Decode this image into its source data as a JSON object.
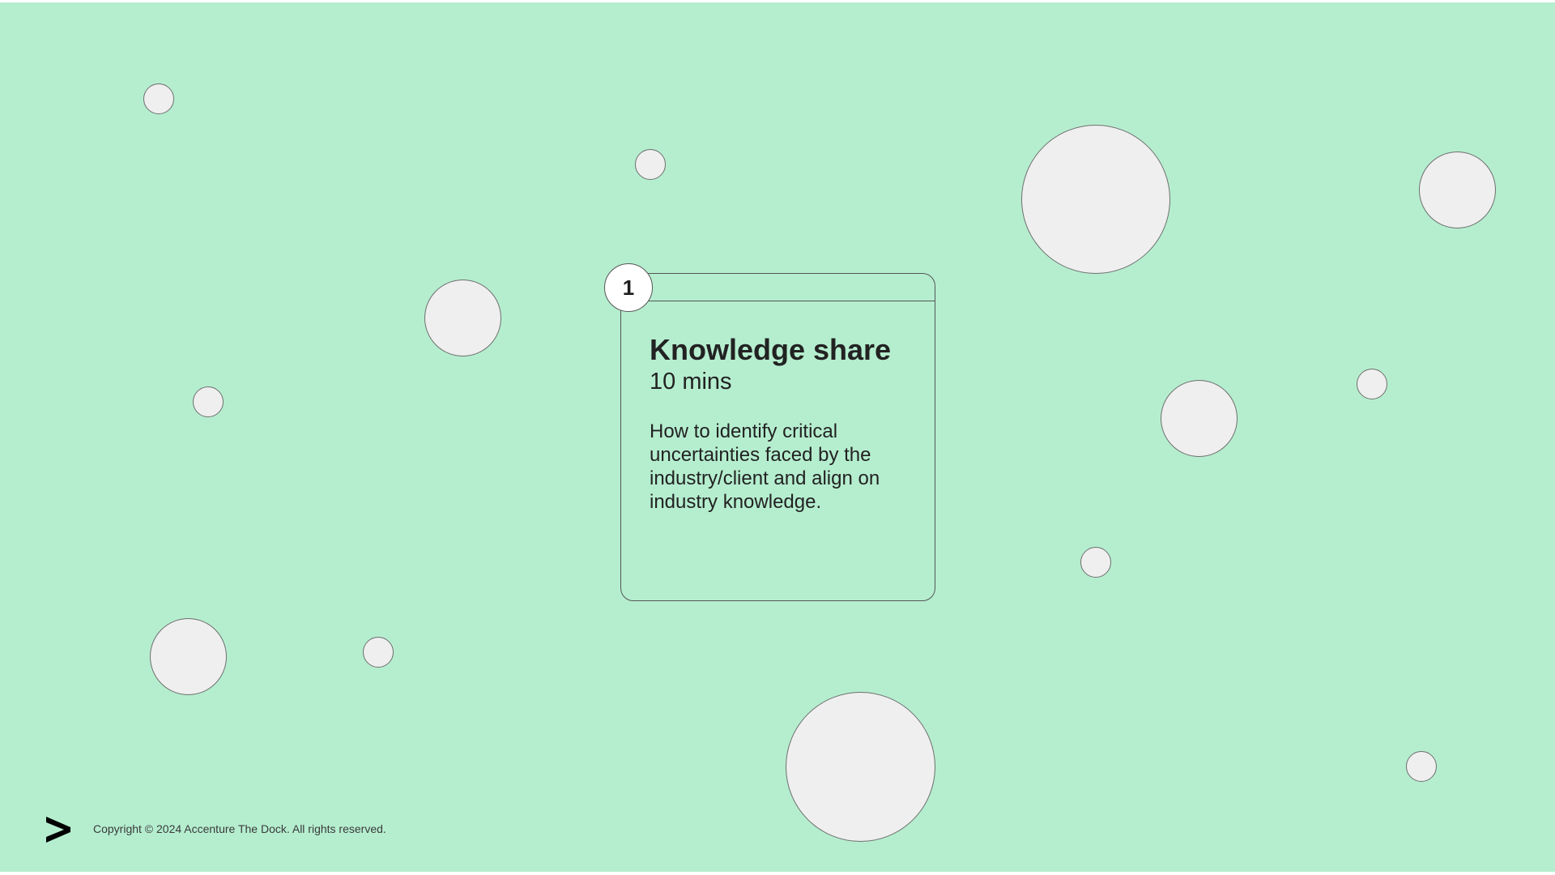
{
  "slide": {
    "background_color": "#b5eecf",
    "bubble_color": "#efefef"
  },
  "card": {
    "step_number": "1",
    "title": "Knowledge share",
    "duration": "10 mins",
    "description": "How to identify critical uncertainties faced by the industry/client and align on industry knowledge."
  },
  "footer": {
    "logo_icon": "accent-chevron-icon",
    "copyright": "Copyright © 2024 Accenture The Dock. All rights reserved."
  }
}
